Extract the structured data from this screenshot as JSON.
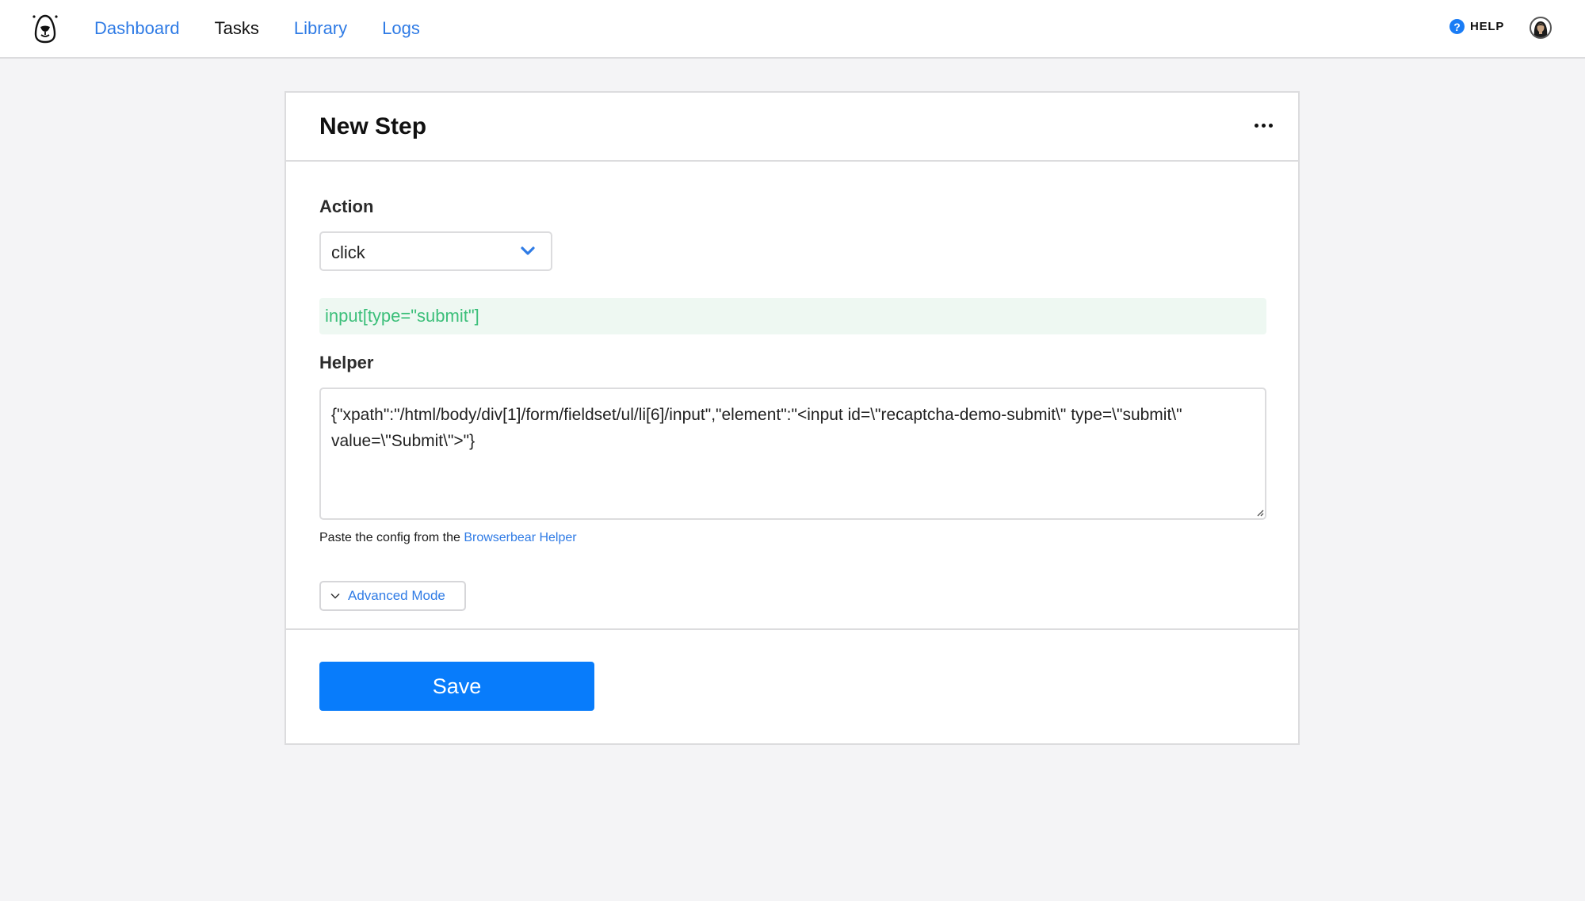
{
  "nav": {
    "logo": "bear-logo",
    "items": [
      {
        "label": "Dashboard",
        "active": false
      },
      {
        "label": "Tasks",
        "active": true
      },
      {
        "label": "Library",
        "active": false
      },
      {
        "label": "Logs",
        "active": false
      }
    ],
    "help_icon": "question-circle-icon",
    "help_label": "HELP",
    "avatar": "user-avatar"
  },
  "card": {
    "title": "New Step",
    "more_icon": "ellipsis-icon",
    "action": {
      "label": "Action",
      "selected": "click"
    },
    "selector": {
      "value": "input[type=\"submit\"]"
    },
    "helper": {
      "label": "Helper",
      "value": "{\"xpath\":\"/html/body/div[1]/form/fieldset/ul/li[6]/input\",\"element\":\"<input id=\\\"recaptcha-demo-submit\\\" type=\\\"submit\\\" value=\\\"Submit\\\">\"}",
      "hint_prefix": "Paste the config from the ",
      "hint_link": "Browserbear Helper"
    },
    "advanced_mode_label": "Advanced Mode",
    "save_label": "Save"
  },
  "colors": {
    "link": "#2f7be5",
    "primary_button": "#087cfb",
    "selector_bg": "#eef8f2",
    "selector_text": "#3cbf7a",
    "page_bg": "#f4f4f6"
  }
}
